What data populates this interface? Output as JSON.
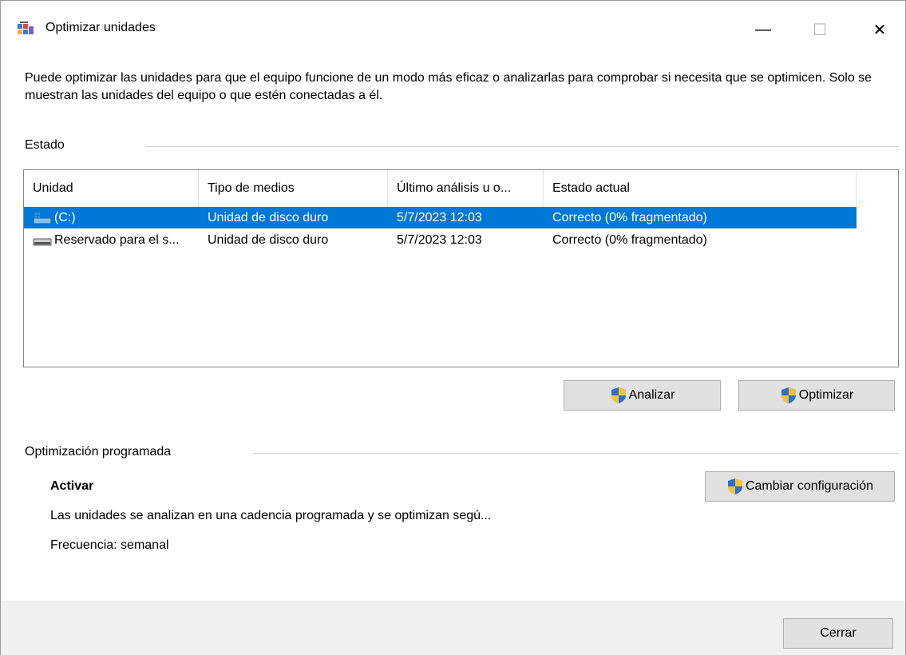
{
  "window": {
    "title": "Optimizar unidades",
    "controls": {
      "minimize": "—",
      "maximize": "☐",
      "close": "✕"
    }
  },
  "description": "Puede optimizar las unidades para que el equipo funcione de un modo más eficaz o analizarlas para comprobar si necesita que se optimicen. Solo se muestran las unidades del equipo o que estén conectadas a él.",
  "status_group": {
    "label": "Estado",
    "columns": [
      "Unidad",
      "Tipo de medios",
      "Último análisis u o...",
      "Estado actual"
    ],
    "rows": [
      {
        "unit": "(C:)",
        "media": "Unidad de disco duro",
        "last": "5/7/2023 12:03",
        "state": "Correcto (0% fragmentado)",
        "icon": "system-drive-icon",
        "selected": true
      },
      {
        "unit": "Reservado para el s...",
        "media": "Unidad de disco duro",
        "last": "5/7/2023 12:03",
        "state": "Correcto (0% fragmentado)",
        "icon": "hard-drive-icon",
        "selected": false
      }
    ]
  },
  "buttons": {
    "analyze": "Analizar",
    "optimize": "Optimizar",
    "change_settings": "Cambiar configuración",
    "close": "Cerrar"
  },
  "scheduled": {
    "label": "Optimización programada",
    "status": "Activar",
    "description": "Las unidades se analizan en una cadencia programada y se optimizan segú...",
    "frequency": "Frecuencia: semanal"
  },
  "colors": {
    "selection": "#0078d7",
    "button_bg": "#e1e1e1",
    "footer_bg": "#f0f0f0"
  }
}
